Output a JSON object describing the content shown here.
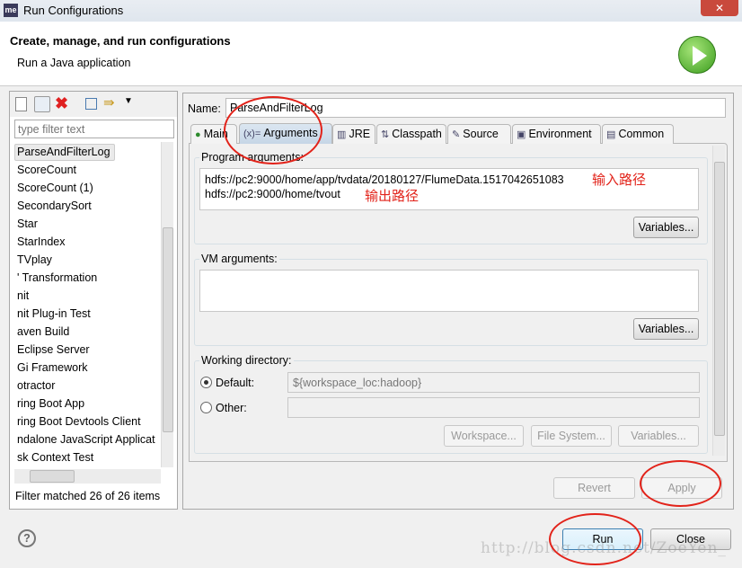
{
  "window": {
    "title": "Run Configurations",
    "app_badge": "me",
    "close": "✕"
  },
  "header": {
    "title": "Create, manage, and run configurations",
    "subtitle": "Run a Java application"
  },
  "sidebar": {
    "filter_placeholder": "type filter text",
    "items": [
      "ParseAndFilterLog",
      "ScoreCount",
      "ScoreCount (1)",
      "SecondarySort",
      "Star",
      "StarIndex",
      "TVplay",
      "' Transformation",
      "nit",
      "nit Plug-in Test",
      "aven Build",
      "Eclipse Server",
      "Gi Framework",
      "otractor",
      "ring Boot App",
      "ring Boot Devtools Client",
      "ndalone JavaScript Applicat",
      "sk Context Test"
    ],
    "selected": "ParseAndFilterLog",
    "status": "Filter matched 26 of 26 items"
  },
  "main": {
    "name_label": "Name:",
    "name_value": "ParseAndFilterLog",
    "tabs": [
      {
        "label": "Main",
        "icon": "main-icon"
      },
      {
        "label": "Arguments",
        "icon": "arguments-icon"
      },
      {
        "label": "JRE",
        "icon": "jre-icon"
      },
      {
        "label": "Classpath",
        "icon": "classpath-icon"
      },
      {
        "label": "Source",
        "icon": "source-icon"
      },
      {
        "label": "Environment",
        "icon": "environment-icon"
      },
      {
        "label": "Common",
        "icon": "common-icon"
      }
    ],
    "active_tab": "Arguments",
    "program_args_label": "Program arguments:",
    "program_args": [
      "hdfs://pc2:9000/home/app/tvdata/20180127/FlumeData.1517042651083",
      "hdfs://pc2:9000/home/tvout"
    ],
    "annotations": [
      "输入路径",
      "输出路径"
    ],
    "variables": "Variables...",
    "vm_args_label": "VM arguments:",
    "workdir_label": "Working directory:",
    "default_label": "Default:",
    "default_value": "${workspace_loc:hadoop}",
    "other_label": "Other:",
    "workspace": "Workspace...",
    "filesystem": "File System...",
    "revert": "Revert",
    "apply": "Apply"
  },
  "footer": {
    "help": "?",
    "run": "Run",
    "close": "Close"
  },
  "watermark": "http://blog.csdn.net/ZoeYen_",
  "colors": {
    "annotation": "#e2231a",
    "accent": "#3c7fb1"
  }
}
